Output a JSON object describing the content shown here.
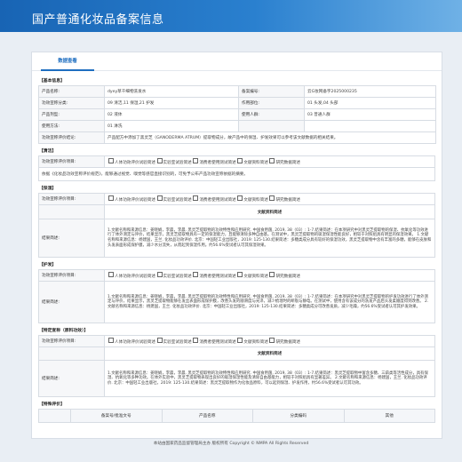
{
  "header": {
    "title": "国产普通化妆品备案信息"
  },
  "tab": {
    "label": "数据查看"
  },
  "basic": {
    "section_title": "【基本信息】",
    "rows": [
      {
        "l1": "产品名称:",
        "v1": "dyey草千细物洗发水",
        "l2": "备案编号:",
        "v2": "云G妆网备字2025000235"
      },
      {
        "l1": "功效宣称分类:",
        "v1": "09 清洁,11 保湿,21 护发",
        "l2": "作用部位:",
        "v2": "01 头发,04 头部"
      },
      {
        "l1": "产品剂型:",
        "v1": "02 液体",
        "l2": "使用人群:",
        "v2": "03 普通人群"
      },
      {
        "l1": "使用方法:",
        "v1": "01 淋洗",
        "l2": "",
        "v2": ""
      }
    ],
    "eval_label": "功效宣称评价结论:",
    "eval_value": "产品配方中添加了黑灵芝（GANODERMA ATRUM）提取物成分，故产品中的保湿、护发效果可以参考该文献数据的相关结果。"
  },
  "clean": {
    "section_title": "【清洁】",
    "label": "功效宣称评价项目:",
    "note": "依据《化妆品功效宣称评价规范》，能够通过视觉、嗅觉等感官直接识别的，可免予公布产品功效宣称依据的摘要。"
  },
  "options": [
    "人体功效评价试验简述",
    "实验室试验简述",
    "消费者使用测试简述",
    "文献资料简述",
    "研究数据简述"
  ],
  "moisture": {
    "section_title": "【保湿】",
    "label": "功效宣称评价项目:",
    "lit_title": "文献资料简述",
    "result_label": "结果简述:",
    "result_text": "1.文献名称和来源信息：姜晓娟，李晨，李晨. 黑灵芝提取物的功效特性和应用研究. 中国食用菌, 2019, 38（03）: 1-7.结果简述：在本项研究中对黑灵芝提取物的保湿、抗氧化等功效进行了体外测定与评价，结果显示，黑灵芝提取物具有一定的保湿能力，且能够清除多种自由基。在测试中，黑灵芝提取物的吸湿保湿性能良好，相较于对照组具有明显的保湿效果。 1.文献名称和来源信息：杨建国，王兰. 化妆品功效评价. 北京：中国轻工业出版社，2019: 125-130.结果简述：多糖类成分具有较好的保湿功效，黑灵芝提取物中含有丰富的多糖，能够在皮肤和头发表面形成保护膜，减少水分流失，从而起到保湿作用。约56.6%受试者认可其保湿效果。"
  },
  "haircare": {
    "section_title": "【护发】",
    "label": "功效宣称评价项目:",
    "result_label": "结果简述:",
    "result_text": "1.文献名称和来源信息：姜晓娟，李晨，李晨. 黑灵芝提取物的功效特性和应用研究. 中国食用菌, 2019, 38（03）: 1-7.结果简述：在本项研究中对黑灵芝提取物的护发功效进行了体外测定与评价，结果显示，黑灵芝提取物能够在发丝表面形成保护膜，改善头发的顺滑度与光泽，减少梳理时的断裂与静电。在测试中，使用含有该成分的洗发产品后头发柔顺度得到改善。 2.文献名称和来源信息：杨建国，王兰. 化妆品功效评价. 北京：中国轻工业出版社，2019: 125-130.结果简述：多糖类成分可改善发质，减少毛躁，约56.6%受试者认可其护发效果。"
  },
  "special": {
    "section_title": "【特定宣称（原料功效）】",
    "label": "功效宣称评价项目:",
    "lit_title": "文献资料简述",
    "result_label": "结果简述:",
    "result_text": "1.文献名称和来源信息：姜晓娟，李晨，李晨. 黑灵芝提取物的功效特性和应用研究. 中国食用菌, 2019, 38（03）: 1-7.结果简述：黑灵芝提取物中富含多糖、三萜类等活性成分，具有保湿、抗氧化等多种功效。在体外实验中，黑灵芝提取物表现出良好的吸湿保湿性能及清除自由基能力，相较于对照组具有显著差异。 2.文献名称和来源信息：杨建国，王兰. 化妆品功效评价. 北京：中国轻工业出版社，2019: 125-130.结果简述：黑灵芝提取物作为化妆品原料，可以起到保湿、护发作用，约56.6%受试者认可其功效。"
  },
  "other": {
    "section_title": "【特殊评价】",
    "columns": [
      "备案号/批准文号",
      "产品名称",
      "分类编码",
      "其他"
    ]
  },
  "footer": {
    "text": "本站由国家药品监督管理局主办 版权所有 Copyright © NMPA All Rights Reserved"
  }
}
